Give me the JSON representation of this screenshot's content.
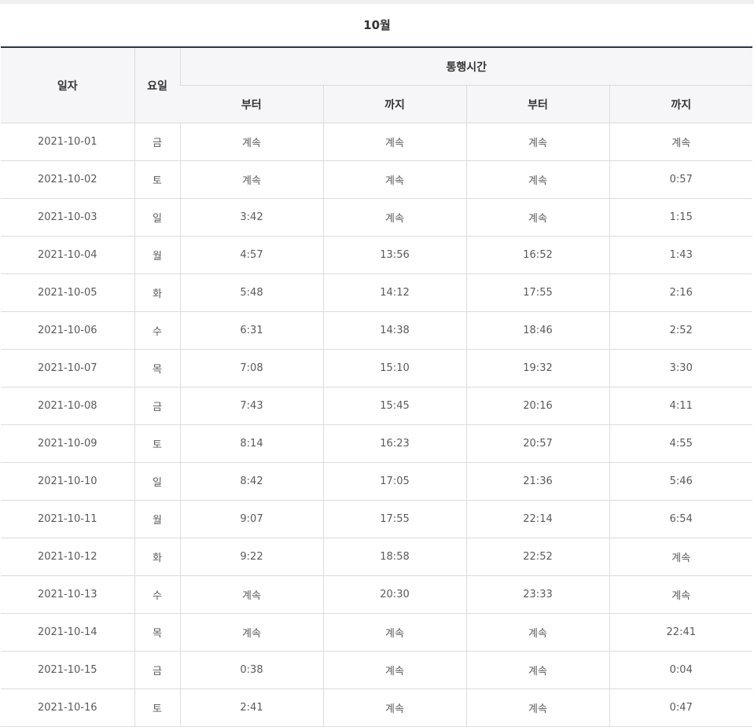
{
  "month_title": "10월",
  "headers": {
    "date": "일자",
    "weekday": "요일",
    "time_group": "통행시간",
    "from_1": "부터",
    "to_1": "까지",
    "from_2": "부터",
    "to_2": "까지"
  },
  "rows": [
    {
      "date": "2021-10-01",
      "weekday": "금",
      "from_1": "계속",
      "to_1": "계속",
      "from_2": "계속",
      "to_2": "계속"
    },
    {
      "date": "2021-10-02",
      "weekday": "토",
      "from_1": "계속",
      "to_1": "계속",
      "from_2": "계속",
      "to_2": "0:57"
    },
    {
      "date": "2021-10-03",
      "weekday": "일",
      "from_1": "3:42",
      "to_1": "계속",
      "from_2": "계속",
      "to_2": "1:15"
    },
    {
      "date": "2021-10-04",
      "weekday": "월",
      "from_1": "4:57",
      "to_1": "13:56",
      "from_2": "16:52",
      "to_2": "1:43"
    },
    {
      "date": "2021-10-05",
      "weekday": "화",
      "from_1": "5:48",
      "to_1": "14:12",
      "from_2": "17:55",
      "to_2": "2:16"
    },
    {
      "date": "2021-10-06",
      "weekday": "수",
      "from_1": "6:31",
      "to_1": "14:38",
      "from_2": "18:46",
      "to_2": "2:52"
    },
    {
      "date": "2021-10-07",
      "weekday": "목",
      "from_1": "7:08",
      "to_1": "15:10",
      "from_2": "19:32",
      "to_2": "3:30"
    },
    {
      "date": "2021-10-08",
      "weekday": "금",
      "from_1": "7:43",
      "to_1": "15:45",
      "from_2": "20:16",
      "to_2": "4:11"
    },
    {
      "date": "2021-10-09",
      "weekday": "토",
      "from_1": "8:14",
      "to_1": "16:23",
      "from_2": "20:57",
      "to_2": "4:55"
    },
    {
      "date": "2021-10-10",
      "weekday": "일",
      "from_1": "8:42",
      "to_1": "17:05",
      "from_2": "21:36",
      "to_2": "5:46"
    },
    {
      "date": "2021-10-11",
      "weekday": "월",
      "from_1": "9:07",
      "to_1": "17:55",
      "from_2": "22:14",
      "to_2": "6:54"
    },
    {
      "date": "2021-10-12",
      "weekday": "화",
      "from_1": "9:22",
      "to_1": "18:58",
      "from_2": "22:52",
      "to_2": "계속"
    },
    {
      "date": "2021-10-13",
      "weekday": "수",
      "from_1": "계속",
      "to_1": "20:30",
      "from_2": "23:33",
      "to_2": "계속"
    },
    {
      "date": "2021-10-14",
      "weekday": "목",
      "from_1": "계속",
      "to_1": "계속",
      "from_2": "계속",
      "to_2": "22:41"
    },
    {
      "date": "2021-10-15",
      "weekday": "금",
      "from_1": "0:38",
      "to_1": "계속",
      "from_2": "계속",
      "to_2": "0:04"
    },
    {
      "date": "2021-10-16",
      "weekday": "토",
      "from_1": "2:41",
      "to_1": "계속",
      "from_2": "계속",
      "to_2": "0:47"
    }
  ]
}
